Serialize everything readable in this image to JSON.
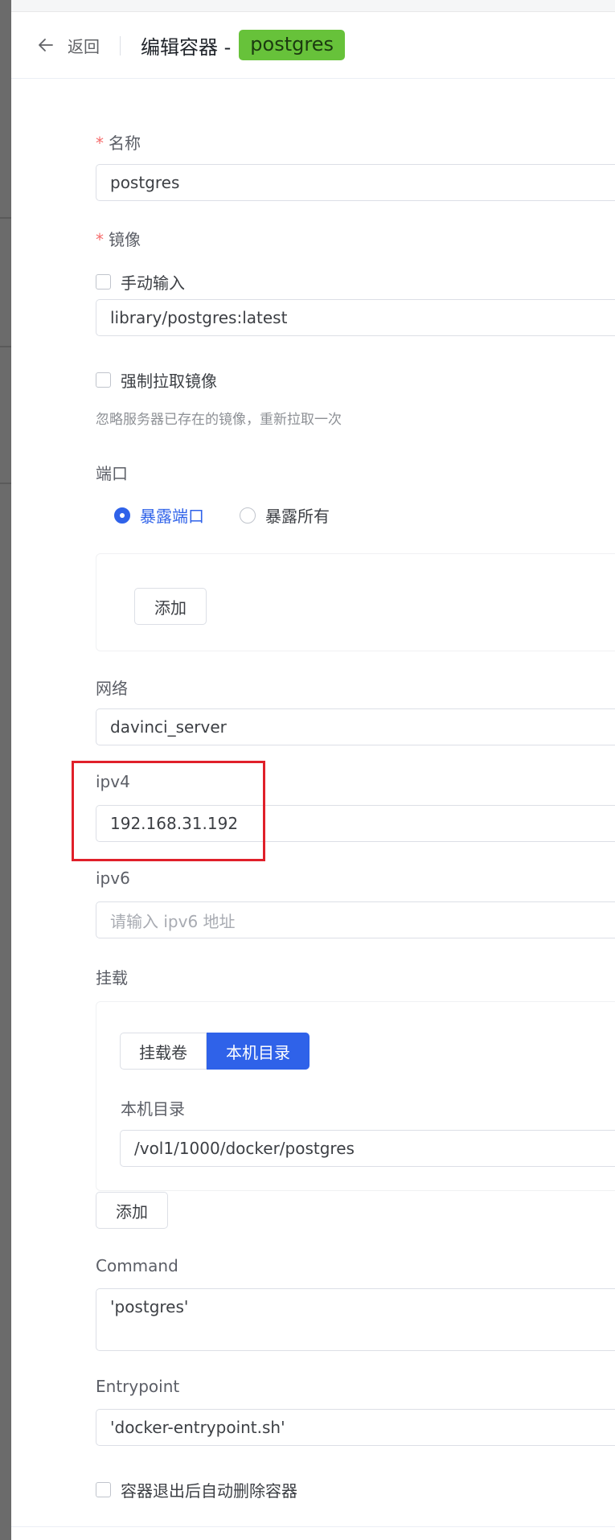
{
  "header": {
    "back_label": "返回",
    "title_prefix": "编辑容器 -",
    "container_name_tag": "postgres",
    "tag_color": "#67c23a"
  },
  "form": {
    "name": {
      "label": "名称",
      "value": "postgres"
    },
    "image": {
      "label": "镜像",
      "manual_input_label": "手动输入",
      "value": "library/postgres:latest",
      "force_pull_label": "强制拉取镜像",
      "force_pull_hint": "忽略服务器已存在的镜像，重新拉取一次"
    },
    "ports": {
      "label": "端口",
      "options": [
        "暴露端口",
        "暴露所有"
      ],
      "selected": "暴露端口",
      "add_label": "添加"
    },
    "network": {
      "label": "网络",
      "value": "davinci_server"
    },
    "ipv4": {
      "label": "ipv4",
      "value": "192.168.31.192"
    },
    "ipv6": {
      "label": "ipv6",
      "placeholder": "请输入 ipv6 地址"
    },
    "mount": {
      "label": "挂载",
      "tabs": [
        "挂载卷",
        "本机目录"
      ],
      "active_tab": "本机目录",
      "host_dir_label": "本机目录",
      "host_dir_value": "/vol1/1000/docker/postgres",
      "add_label": "添加"
    },
    "command": {
      "label": "Command",
      "value": "'postgres'"
    },
    "entrypoint": {
      "label": "Entrypoint",
      "value": "'docker-entrypoint.sh'"
    },
    "auto_remove_label": "容器退出后自动删除容器"
  },
  "colors": {
    "primary": "#2f62e9",
    "required": "#f56c6c",
    "highlight_box": "#e0202a"
  },
  "icons": {
    "back": "arrow-left-icon"
  }
}
